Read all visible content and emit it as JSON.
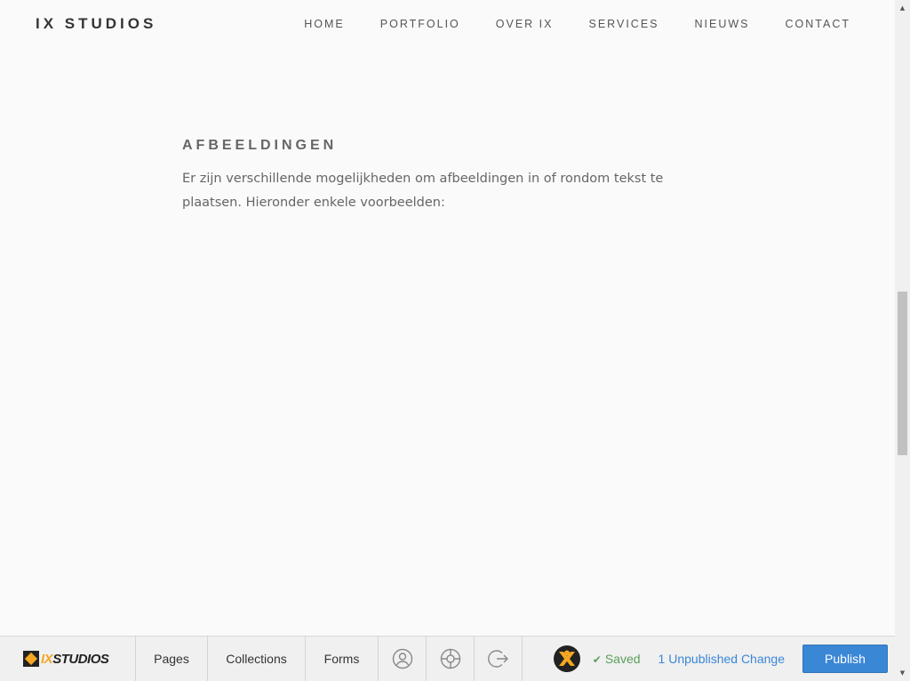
{
  "site": {
    "logo": "IX STUDIOS",
    "nav": [
      "HOME",
      "PORTFOLIO",
      "OVER IX",
      "SERVICES",
      "NIEUWS",
      "CONTACT"
    ]
  },
  "section": {
    "heading": "AFBEELDINGEN",
    "body": "Er zijn verschillende mogelijkheden om afbeeldingen in of rondom tekst te plaatsen. Hieronder enkele voorbeelden:"
  },
  "editor": {
    "logo_prefix": "IX",
    "logo_suffix": "STUDIOS",
    "tabs": [
      "Pages",
      "Collections",
      "Forms"
    ],
    "icons": [
      "account-icon",
      "help-lifebuoy-icon",
      "logout-icon"
    ],
    "saved": "Saved",
    "unpublished": "1 Unpublished Change",
    "publish": "Publish"
  },
  "colors": {
    "accent": "#3a87d6",
    "saved": "#5a9e5a",
    "brand": "#f5a623"
  }
}
